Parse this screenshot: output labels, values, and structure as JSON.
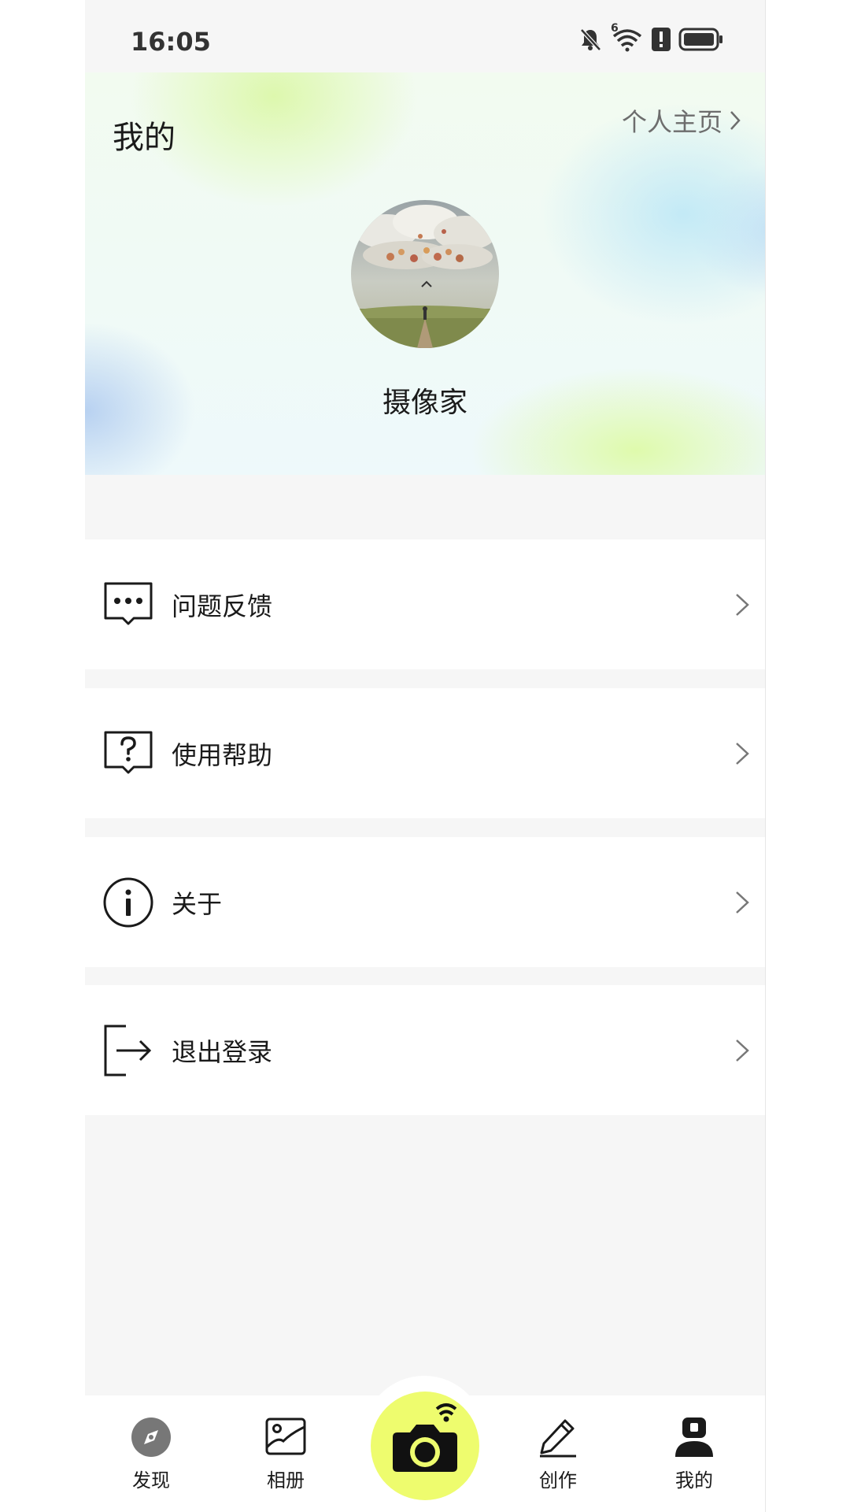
{
  "status_bar": {
    "time": "16:05",
    "signal_superscript": "6"
  },
  "header": {
    "title": "我的",
    "homepage_link": "个人主页"
  },
  "profile": {
    "username": "摄像家"
  },
  "menu": [
    {
      "label": "问题反馈",
      "icon": "message-dots-icon"
    },
    {
      "label": "使用帮助",
      "icon": "help-question-icon"
    },
    {
      "label": "关于",
      "icon": "info-icon"
    },
    {
      "label": "退出登录",
      "icon": "logout-icon"
    }
  ],
  "bottom_nav": [
    {
      "label": "发现",
      "icon": "compass-icon"
    },
    {
      "label": "相册",
      "icon": "album-icon"
    },
    {
      "label": "",
      "icon": "camera-wifi-icon"
    },
    {
      "label": "创作",
      "icon": "pencil-icon"
    },
    {
      "label": "我的",
      "icon": "person-icon"
    }
  ],
  "colors": {
    "camera_accent": "#eefc6e",
    "page_bg": "#f6f6f6"
  }
}
